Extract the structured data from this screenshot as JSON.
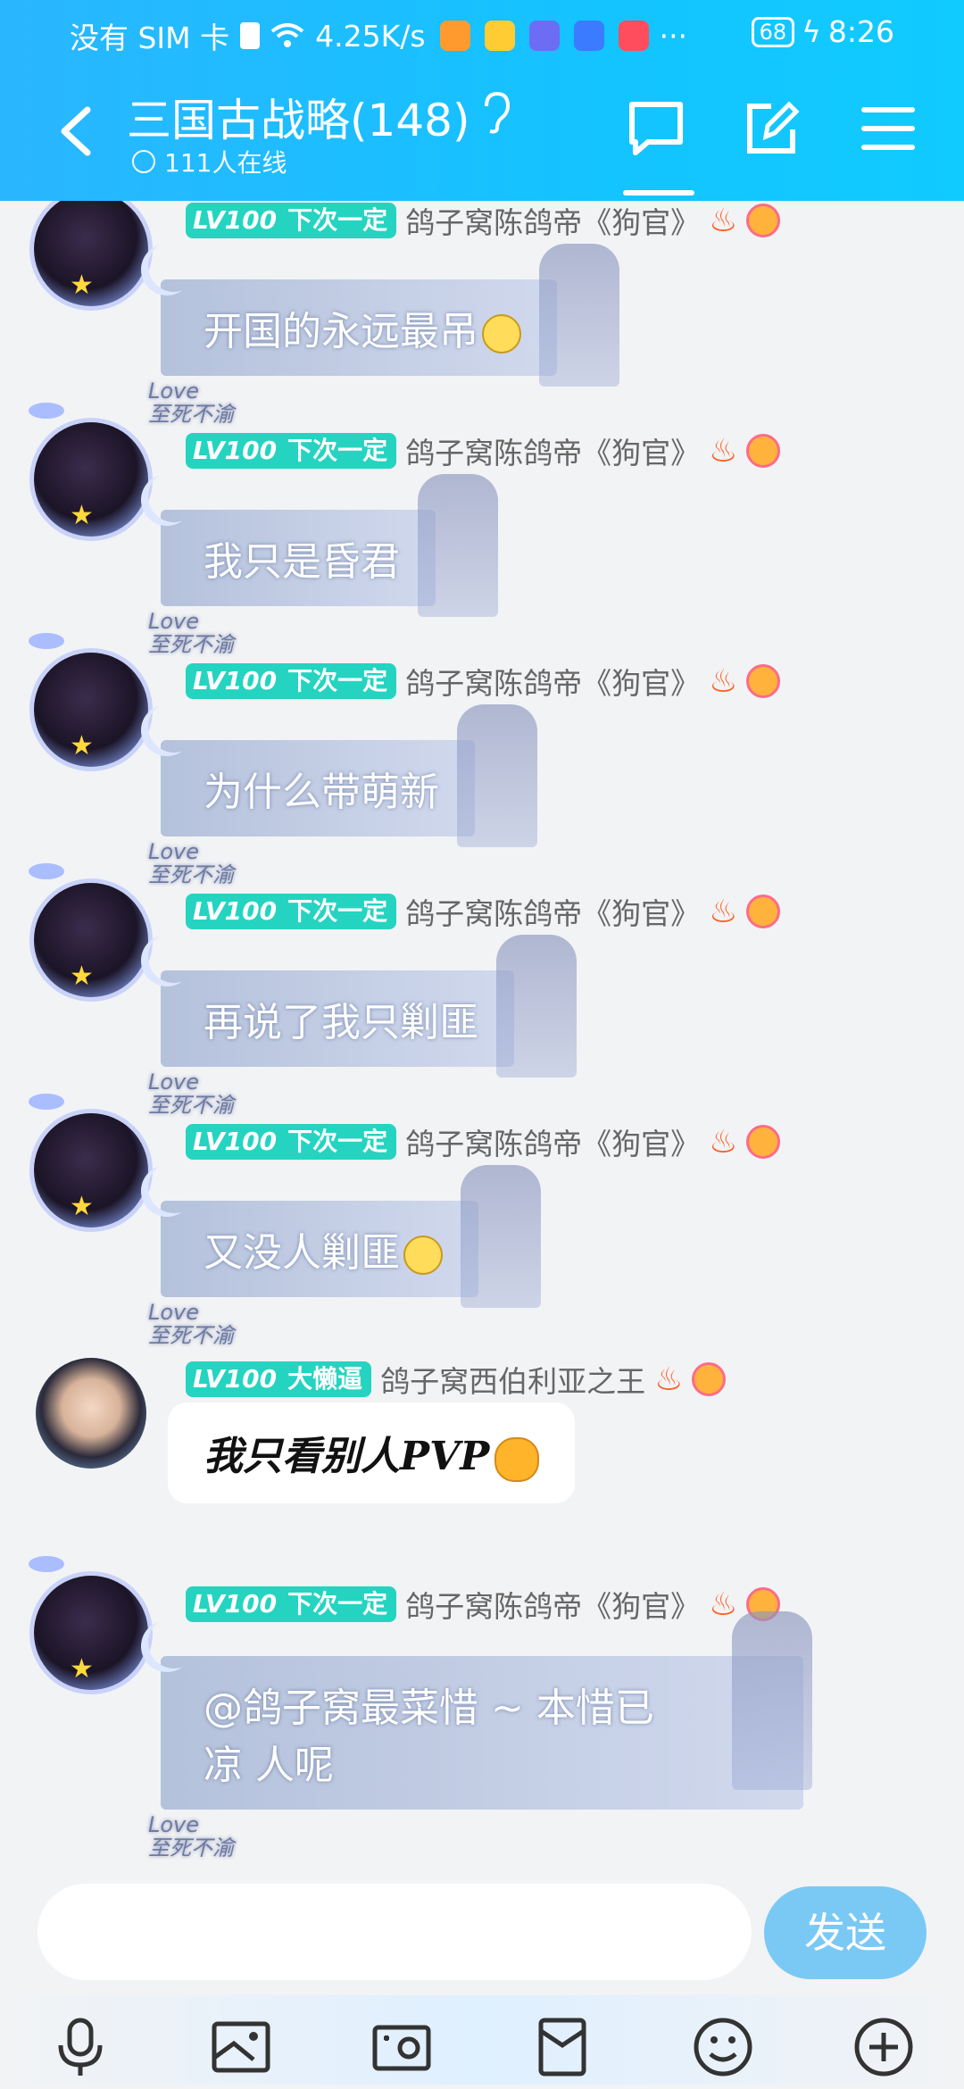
{
  "status_bar": {
    "carrier": "没有 SIM 卡",
    "speed": "4.25K/s",
    "more": "···",
    "battery": "68",
    "time": "8:26"
  },
  "header": {
    "title": "三国古战略(148)",
    "online": "111人在线"
  },
  "messages": [
    {
      "level": "LV100",
      "title": "下次一定",
      "sender": "鸽子窝陈鸽帝《狗官》",
      "text": "开国的永远最吊",
      "emoji": true
    },
    {
      "level": "LV100",
      "title": "下次一定",
      "sender": "鸽子窝陈鸽帝《狗官》",
      "text": "我只是昏君",
      "emoji": false
    },
    {
      "level": "LV100",
      "title": "下次一定",
      "sender": "鸽子窝陈鸽帝《狗官》",
      "text": "为什么带萌新",
      "emoji": false
    },
    {
      "level": "LV100",
      "title": "下次一定",
      "sender": "鸽子窝陈鸽帝《狗官》",
      "text": "再说了我只剿匪",
      "emoji": false
    },
    {
      "level": "LV100",
      "title": "下次一定",
      "sender": "鸽子窝陈鸽帝《狗官》",
      "text": "又没人剿匪",
      "emoji": true
    },
    {
      "level": "LV100",
      "title": "大懒逼",
      "sender": "鸽子窝西伯利亚之王",
      "text": "我只看别人PVP",
      "emoji": true
    },
    {
      "level": "LV100",
      "title": "下次一定",
      "sender": "鸽子窝陈鸽帝《狗官》",
      "text": "@鸽子窝最菜惜 ~ 本惜已凉 人呢",
      "line1": "@鸽子窝最菜惜 ~ 本惜已",
      "line2": "凉 人呢",
      "emoji": false
    }
  ],
  "bubble_decor": {
    "love": "Love",
    "motto": "至死不渝"
  },
  "input": {
    "placeholder": "",
    "send_label": "发送"
  },
  "colors": {
    "header": "#1bbcff",
    "badge": "#25d4c0",
    "send": "#7ac9f5"
  }
}
